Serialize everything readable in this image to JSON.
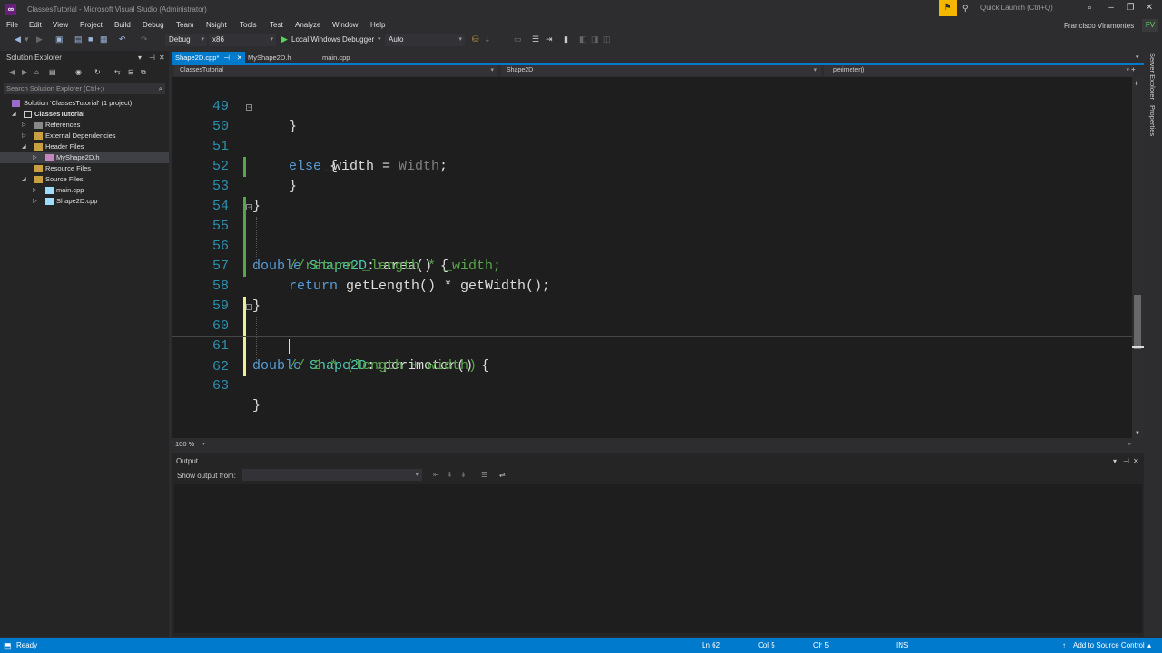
{
  "window": {
    "title": "ClassesTutorial - Microsoft Visual Studio (Administrator)",
    "logo": "vs-logo",
    "quick_launch_placeholder": "Quick Launch (Ctrl+Q)",
    "user": "Francisco Viramontes",
    "user_initials": "FV"
  },
  "menu": [
    "File",
    "Edit",
    "View",
    "Project",
    "Build",
    "Debug",
    "Team",
    "Nsight",
    "Tools",
    "Test",
    "Analyze",
    "Window",
    "Help"
  ],
  "toolbar": {
    "configuration": "Debug",
    "platform": "x86",
    "debugger": "Local Windows Debugger",
    "debugger_mode": "Auto"
  },
  "solution_explorer": {
    "title": "Solution Explorer",
    "search_placeholder": "Search Solution Explorer (Ctrl+;)",
    "tree": [
      {
        "label": "Solution 'ClassesTutorial' (1 project)",
        "icon": "solution-icon"
      },
      {
        "label": "ClassesTutorial",
        "icon": "project-icon"
      },
      {
        "label": "References",
        "icon": "references-icon"
      },
      {
        "label": "External Dependencies",
        "icon": "folder-icon"
      },
      {
        "label": "Header Files",
        "icon": "folder-icon"
      },
      {
        "label": "MyShape2D.h",
        "icon": "header-file-icon"
      },
      {
        "label": "Resource Files",
        "icon": "folder-icon"
      },
      {
        "label": "Source Files",
        "icon": "folder-icon"
      },
      {
        "label": "main.cpp",
        "icon": "cpp-file-icon"
      },
      {
        "label": "Shape2D.cpp",
        "icon": "cpp-file-icon"
      }
    ]
  },
  "editor": {
    "tabs": [
      {
        "label": "Shape2D.cpp*",
        "active": true
      },
      {
        "label": "MyShape2D.h",
        "active": false
      },
      {
        "label": "main.cpp",
        "active": false
      }
    ],
    "nav": {
      "project": "ClassesTutorial",
      "scope": "Shape2D",
      "member": "perimeter()"
    },
    "line_numbers": [
      "49",
      "50",
      "51",
      "52",
      "53",
      "54",
      "55",
      "56",
      "57",
      "58",
      "59",
      "60",
      "61",
      "62",
      "63"
    ],
    "code": {
      "l49": "}",
      "l50_kw": "else",
      "l50_rest": " {",
      "l51_a": "_width = ",
      "l51_b": "Width",
      "l51_c": ";",
      "l52": "}",
      "l53": "}",
      "l55_kw": "double",
      "l55_ty": "Shape2D",
      "l55_rest": "::area() {",
      "l56_cm": "//return _length * _width;",
      "l57_kw": "return",
      "l57_rest": " getLength() * getWidth();",
      "l58": "}",
      "l60_kw": "double",
      "l60_ty": "Shape2D",
      "l60_rest": "::perimeter() {",
      "l61_cm": "// 2 * (length + width)",
      "l63": "}"
    },
    "zoom": "100 %"
  },
  "output": {
    "title": "Output",
    "show_output_from": "Show output from:"
  },
  "right_sidebar": [
    "Server Explorer",
    "Properties"
  ],
  "status": {
    "state": "Ready",
    "line": "Ln 62",
    "col": "Col 5",
    "ch": "Ch 5",
    "mode": "INS",
    "source_control": "Add to Source Control"
  },
  "colors": {
    "accent": "#007acc",
    "keyword": "#569cd6",
    "type": "#4ec9b0",
    "comment": "#57a64a",
    "line_number": "#2b91af"
  }
}
